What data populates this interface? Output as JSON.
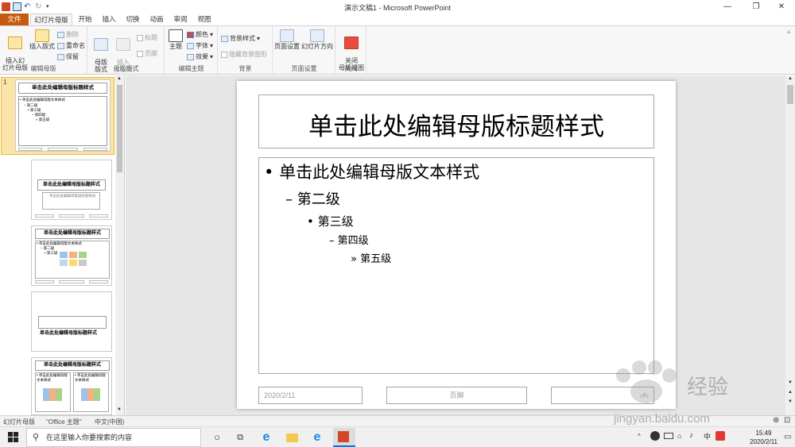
{
  "app_title": "演示文稿1 - Microsoft PowerPoint",
  "tabs": [
    "文件",
    "幻灯片母版",
    "开始",
    "插入",
    "切换",
    "动画",
    "审阅",
    "视图"
  ],
  "ribbon": {
    "groups": {
      "edit_master": {
        "label": "编辑母版",
        "insert_slide_master": "插入幻\n灯片母版",
        "insert_layout": "插入版式",
        "delete": "删除",
        "rename": "重命名",
        "preserve": "保留"
      },
      "master_layout": {
        "label": "母版版式",
        "master_layout_btn": "母版\n版式",
        "insert_placeholder": "插入\n占位符",
        "title_chk": "标题",
        "footer_chk": "页脚"
      },
      "edit_theme": {
        "label": "编辑主题",
        "themes": "主题",
        "colors": "颜色",
        "fonts": "字体",
        "effects": "效果"
      },
      "background": {
        "label": "背景",
        "background_styles": "背景样式",
        "hide_bg_graphics": "隐藏背景图形"
      },
      "page_setup": {
        "label": "页面设置",
        "page_setup": "页面设置",
        "orientation": "幻灯片方向"
      },
      "close": {
        "label": "关闭",
        "close_master_view": "关闭\n母版视图"
      }
    }
  },
  "thumbnails": [
    {
      "index": "1",
      "title": "单击此处编辑母版标题样式",
      "lines": [
        "• 单击此处编辑母版文本样式",
        "– 第二级",
        "• 第三级",
        "– 第四级",
        "» 第五级"
      ]
    },
    {
      "title": "单击此处编辑母版标题样式",
      "lines": [
        "单击此处编辑母版副标题样式"
      ]
    },
    {
      "title": "单击此处编辑母版标题样式",
      "lines": [
        "• 单击此处编辑母版文本样式",
        "– 第二级",
        "• 第三级"
      ]
    },
    {
      "title": "单击此处编辑母版标题样式",
      "lines": []
    },
    {
      "title": "单击此处编辑母版标题样式",
      "lines": [
        "• 单击此处编辑母版文本样式",
        "• 单击此处编辑母版文本样式"
      ]
    }
  ],
  "slide": {
    "title": "单击此处编辑母版标题样式",
    "levels": [
      "单击此处编辑母版文本样式",
      "第二级",
      "第三级",
      "第四级",
      "第五级"
    ],
    "bullets": [
      "•",
      "–",
      "•",
      "–",
      "»"
    ],
    "date": "2020/2/11",
    "footer": "页脚",
    "slide_number": "‹#›"
  },
  "statusbar": {
    "view": "幻灯片母版",
    "theme": "\"Office 主题\"",
    "language": "中文(中国)"
  },
  "taskbar": {
    "search_placeholder": "在这里输入你要搜索的内容",
    "time": "15:49",
    "date": "2020/2/11"
  },
  "watermark": {
    "text": "jingyan.baidu.com",
    "brand": "经验"
  },
  "colors": {
    "file_tab": "#c55a11",
    "ppt_icon": "#d24726",
    "ribbon_bg": "#f7f7f7",
    "canvas_bg": "#e6e6e6",
    "selected_thumb": "#fce4a8"
  }
}
